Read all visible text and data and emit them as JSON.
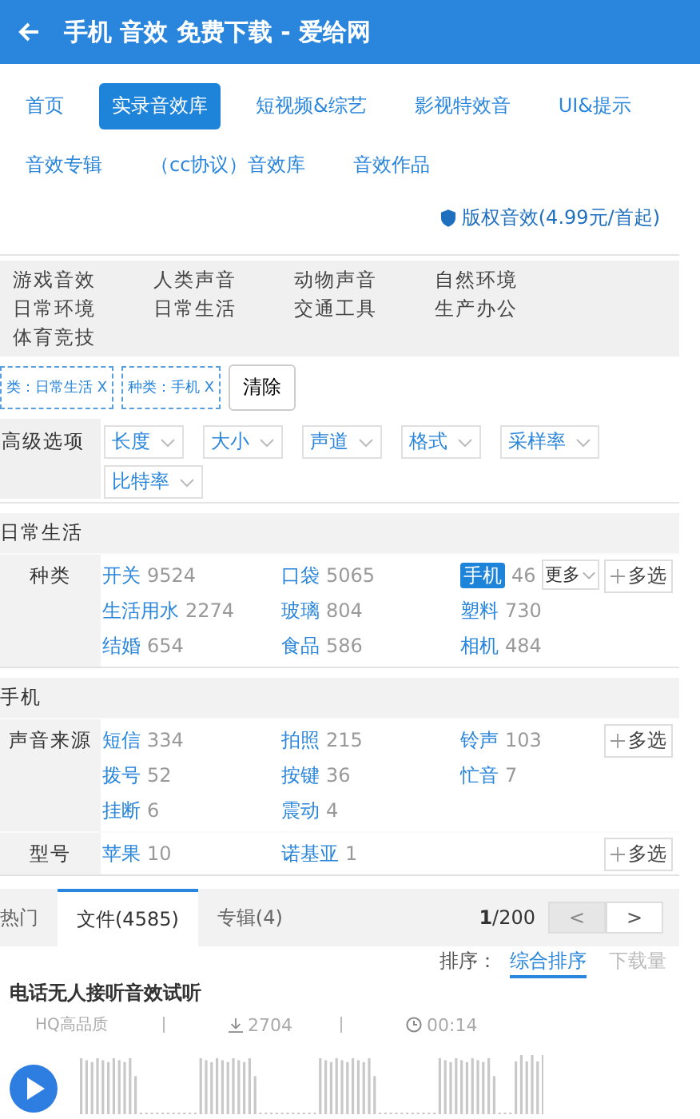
{
  "header": {
    "title": "手机 音效 免费下载 - 爱给网"
  },
  "nav": {
    "tabs": [
      {
        "label": "首页",
        "selected": false
      },
      {
        "label": "实录音效库",
        "selected": true
      },
      {
        "label": "短视频&综艺",
        "selected": false
      },
      {
        "label": "影视特效音",
        "selected": false
      },
      {
        "label": "UI&提示",
        "selected": false
      },
      {
        "label": "音效专辑",
        "selected": false
      },
      {
        "label": "（cc协议）音效库",
        "selected": false
      },
      {
        "label": "音效作品",
        "selected": false
      }
    ]
  },
  "copyright_link": "版权音效(4.99元/首起)",
  "categories": [
    "游戏音效",
    "人类声音",
    "动物声音",
    "自然环境",
    "日常环境",
    "日常生活",
    "交通工具",
    "生产办公",
    "体育竞技"
  ],
  "active_filters": [
    "类：日常生活 X",
    "种类：手机 X"
  ],
  "clear_button": "清除",
  "advanced": {
    "label": "高级选项",
    "dropdowns": [
      "长度",
      "大小",
      "声道",
      "格式",
      "采样率",
      "比特率"
    ]
  },
  "sections": [
    {
      "title": "日常生活",
      "rows": [
        {
          "label": "种类",
          "more": "更多",
          "multi": "多选",
          "items": [
            {
              "name": "开关",
              "count": "9524",
              "selected": false
            },
            {
              "name": "口袋",
              "count": "5065",
              "selected": false
            },
            {
              "name": "手机",
              "count": "46",
              "selected": true
            },
            {
              "name": "生活用水",
              "count": "2274",
              "selected": false
            },
            {
              "name": "玻璃",
              "count": "804",
              "selected": false
            },
            {
              "name": "塑料",
              "count": "730",
              "selected": false
            },
            {
              "name": "结婚",
              "count": "654",
              "selected": false
            },
            {
              "name": "食品",
              "count": "586",
              "selected": false
            },
            {
              "name": "相机",
              "count": "484",
              "selected": false
            }
          ]
        }
      ]
    },
    {
      "title": "手机",
      "rows": [
        {
          "label": "声音来源",
          "multi": "多选",
          "items": [
            {
              "name": "短信",
              "count": "334",
              "selected": false
            },
            {
              "name": "拍照",
              "count": "215",
              "selected": false
            },
            {
              "name": "铃声",
              "count": "103",
              "selected": false
            },
            {
              "name": "拨号",
              "count": "52",
              "selected": false
            },
            {
              "name": "按键",
              "count": "36",
              "selected": false
            },
            {
              "name": "忙音",
              "count": "7",
              "selected": false
            },
            {
              "name": "挂断",
              "count": "6",
              "selected": false
            },
            {
              "name": "震动",
              "count": "4",
              "selected": false
            }
          ]
        },
        {
          "label": "型号",
          "multi": "多选",
          "items": [
            {
              "name": "苹果",
              "count": "10",
              "selected": false
            },
            {
              "name": "诺基亚",
              "count": "1",
              "selected": false
            }
          ]
        }
      ]
    }
  ],
  "result_tabs": [
    {
      "label": "热门",
      "selected": false
    },
    {
      "label": "文件(4585)",
      "selected": true
    },
    {
      "label": "专辑(4)",
      "selected": false
    }
  ],
  "pagination": {
    "page": "**1**/200",
    "prev": {
      "label": "<",
      "disabled": true
    },
    "next": {
      "label": ">",
      "disabled": false
    }
  },
  "sort": {
    "label": "排序：",
    "options": [
      {
        "label": "综合排序",
        "selected": true
      },
      {
        "label": "下载量",
        "selected": false
      }
    ]
  },
  "result": {
    "title": "电话无人接听音效试听",
    "quality": "HQ高品质",
    "downloads": "2704",
    "duration": "00:14"
  }
}
